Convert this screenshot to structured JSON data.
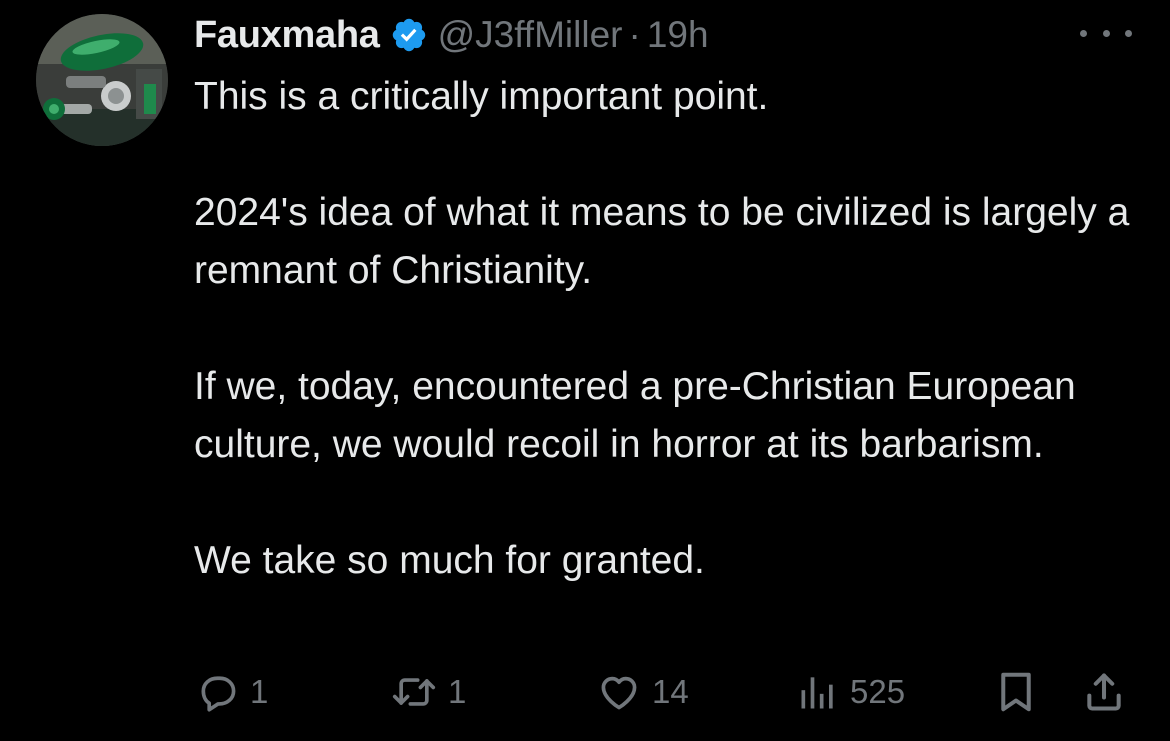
{
  "tweet": {
    "author": {
      "display_name": "Fauxmaha",
      "handle": "@J3ffMiller",
      "verified": true,
      "avatar_icon": "green-motorcycle-avatar"
    },
    "separator": "·",
    "time": "19h",
    "more_icon": "more-dots-icon",
    "text_paragraphs": [
      "This is a critically important point.",
      "2024's idea of what it means to be civilized is largely a remnant of Christianity.",
      "If we, today, encountered a pre-Christian European culture, we would recoil in horror at its barbarism.",
      "We take so much for granted."
    ],
    "actions": {
      "reply_count": "1",
      "repost_count": "1",
      "like_count": "14",
      "views_count": "525"
    }
  },
  "colors": {
    "background": "#000000",
    "text_primary": "#e7e9ea",
    "text_secondary": "#71767b",
    "verified_blue": "#1d9bf0"
  }
}
